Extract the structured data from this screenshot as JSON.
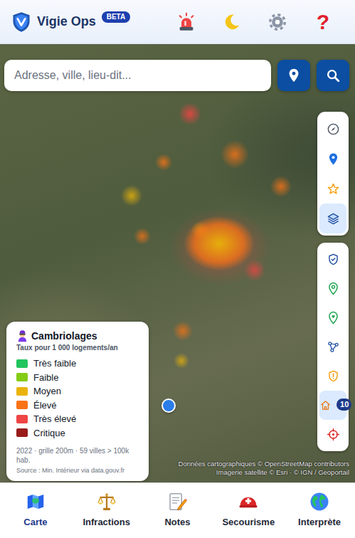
{
  "app": {
    "title": "Vigie Ops",
    "badge": "BETA"
  },
  "header": {
    "help": "?"
  },
  "search": {
    "placeholder": "Adresse, ville, lieu-dit..."
  },
  "map_tools": [
    {
      "selected": false
    },
    {
      "selected": false
    },
    {
      "selected": false
    },
    {
      "selected": true
    }
  ],
  "layer_tools": [
    {
      "selected": false
    },
    {
      "selected": false
    },
    {
      "selected": false
    },
    {
      "selected": false
    },
    {
      "selected": false
    },
    {
      "selected": true,
      "badge": "10"
    },
    {
      "selected": false
    }
  ],
  "legend": {
    "title": "Cambriolages",
    "subtitle": "Taux pour 1 000 logements/an",
    "items": [
      {
        "label": "Très faible",
        "color": "#22c55e"
      },
      {
        "label": "Faible",
        "color": "#84cc16"
      },
      {
        "label": "Moyen",
        "color": "#eab308"
      },
      {
        "label": "Élevé",
        "color": "#f97316"
      },
      {
        "label": "Très élevé",
        "color": "#ef4444"
      },
      {
        "label": "Critique",
        "color": "#991b1b"
      }
    ],
    "footer": "2022 · grille 200m · 59 villes > 100k hab.",
    "source": "Source : Min. Intérieur via data.gouv.fr"
  },
  "attribution": [
    "Données cartographiques © OpenStreetMap contributors",
    "Imagerie satellite © Esri · © IGN / Geoportail"
  ],
  "bottom_nav": [
    {
      "label": "Carte",
      "selected": true
    },
    {
      "label": "Infractions",
      "selected": false
    },
    {
      "label": "Notes",
      "selected": false
    },
    {
      "label": "Secourisme",
      "selected": false
    },
    {
      "label": "Interprète",
      "selected": false
    }
  ]
}
